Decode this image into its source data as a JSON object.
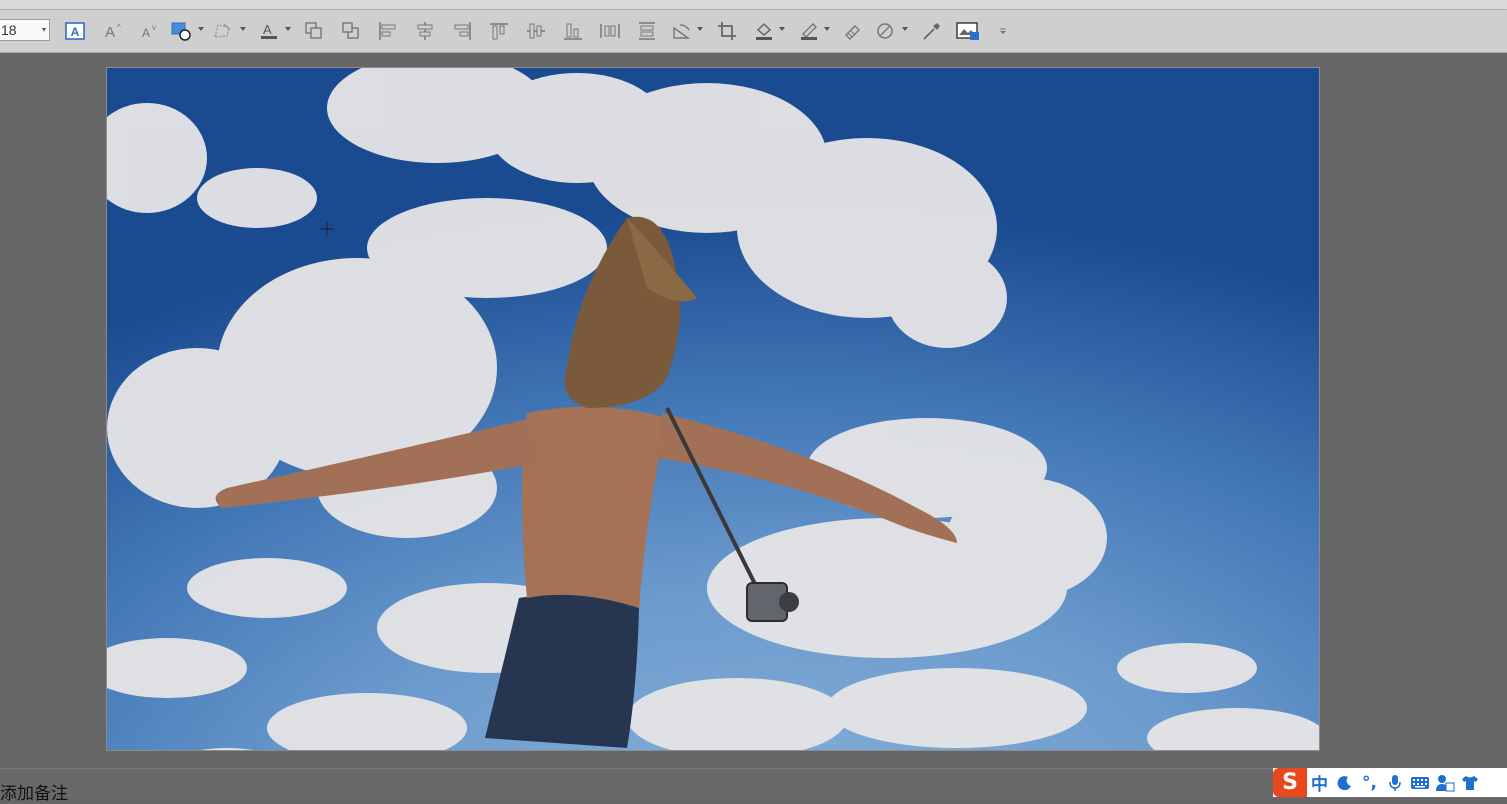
{
  "toolbar": {
    "font_size_value": "18",
    "buttons": [
      {
        "name": "text-box-icon"
      },
      {
        "name": "increase-font-size-icon"
      },
      {
        "name": "decrease-font-size-icon"
      },
      {
        "name": "shape-fill-icon"
      },
      {
        "name": "edit-shape-icon"
      },
      {
        "name": "font-color-icon"
      },
      {
        "name": "bring-forward-icon"
      },
      {
        "name": "send-backward-icon"
      },
      {
        "name": "align-left-icon"
      },
      {
        "name": "align-center-icon"
      },
      {
        "name": "align-right-icon"
      },
      {
        "name": "align-top-icon"
      },
      {
        "name": "align-middle-icon"
      },
      {
        "name": "align-bottom-icon"
      },
      {
        "name": "distribute-horizontally-icon"
      },
      {
        "name": "distribute-vertically-icon"
      },
      {
        "name": "rotate-icon"
      },
      {
        "name": "crop-icon"
      },
      {
        "name": "fill-color-icon"
      },
      {
        "name": "outline-color-icon"
      },
      {
        "name": "format-painter-icon"
      },
      {
        "name": "shape-effects-icon"
      },
      {
        "name": "eyedropper-icon"
      },
      {
        "name": "change-picture-icon"
      },
      {
        "name": "more-options-icon"
      }
    ]
  },
  "slide": {
    "image_description_name": "slide-photo"
  },
  "notes": {
    "placeholder": "添加备注"
  },
  "ime": {
    "logo": "S",
    "mode": "中",
    "punct": "°,"
  },
  "colors": {
    "toolbar_bg": "#cfcfcf",
    "canvas_bg": "#676767",
    "icon_accent": "#1f6fd1",
    "ime_brand": "#e8481c"
  }
}
